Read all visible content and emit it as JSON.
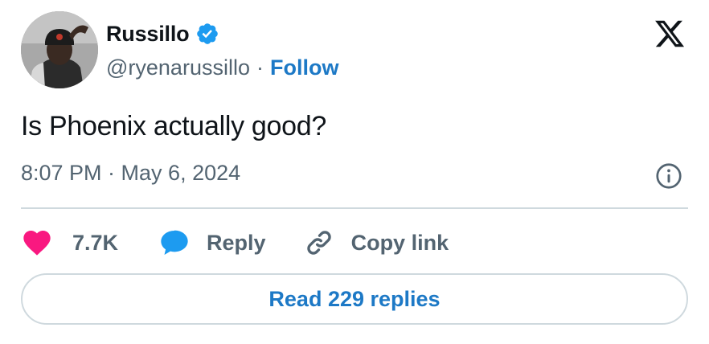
{
  "author": {
    "name": "Russillo",
    "handle": "@ryenarussillo",
    "separator": "·",
    "follow_label": "Follow",
    "verified_icon": "verified-badge-icon",
    "verified_color": "#1d9bf0"
  },
  "platform_logo": "x-logo-icon",
  "tweet": {
    "text": "Is Phoenix actually good?",
    "timestamp": "8:07 PM · May 6, 2024"
  },
  "actions": {
    "like_count": "7.7K",
    "like_color": "#f91880",
    "reply_label": "Reply",
    "reply_color": "#1d9bf0",
    "copy_link_label": "Copy link"
  },
  "read_replies_label": "Read 229 replies",
  "colors": {
    "text": "#0f1419",
    "secondary": "#536471",
    "link": "#1d79c6",
    "border": "#cfd9de"
  }
}
